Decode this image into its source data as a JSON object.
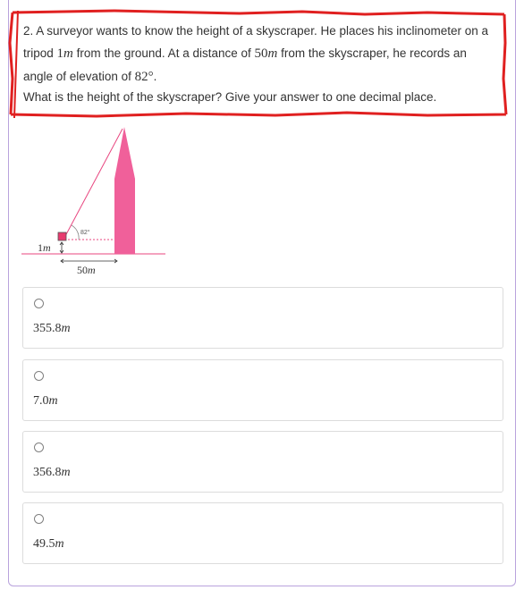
{
  "question": {
    "number": "2.",
    "sentence_1_a": "A surveyor wants to know the height of a skyscraper. He places his inclinometer on a tripod ",
    "tripod_height": "1",
    "tripod_unit": "m",
    "sentence_1_b": " from the ground. At a distance of ",
    "distance": "50",
    "distance_unit": "m",
    "sentence_1_c": " from the skyscraper, he records an angle of elevation of ",
    "angle": "82°",
    "sentence_1_d": ".",
    "prompt": "What is the height of the skyscraper? Give your answer to one decimal place."
  },
  "diagram": {
    "angle_label": "82°",
    "height_label_num": "1",
    "height_label_unit": "m",
    "distance_label_num": "50",
    "distance_label_unit": "m",
    "colors": {
      "building": "#f0609a",
      "line": "#e8457f",
      "ground": "#e8457f"
    }
  },
  "options": [
    {
      "value": "355.8",
      "unit": "m"
    },
    {
      "value": "7.0",
      "unit": "m"
    },
    {
      "value": "356.8",
      "unit": "m"
    },
    {
      "value": "49.5",
      "unit": "m"
    }
  ],
  "colors": {
    "annotation_border": "#e02020",
    "frame_border": "#b9a3dd"
  }
}
